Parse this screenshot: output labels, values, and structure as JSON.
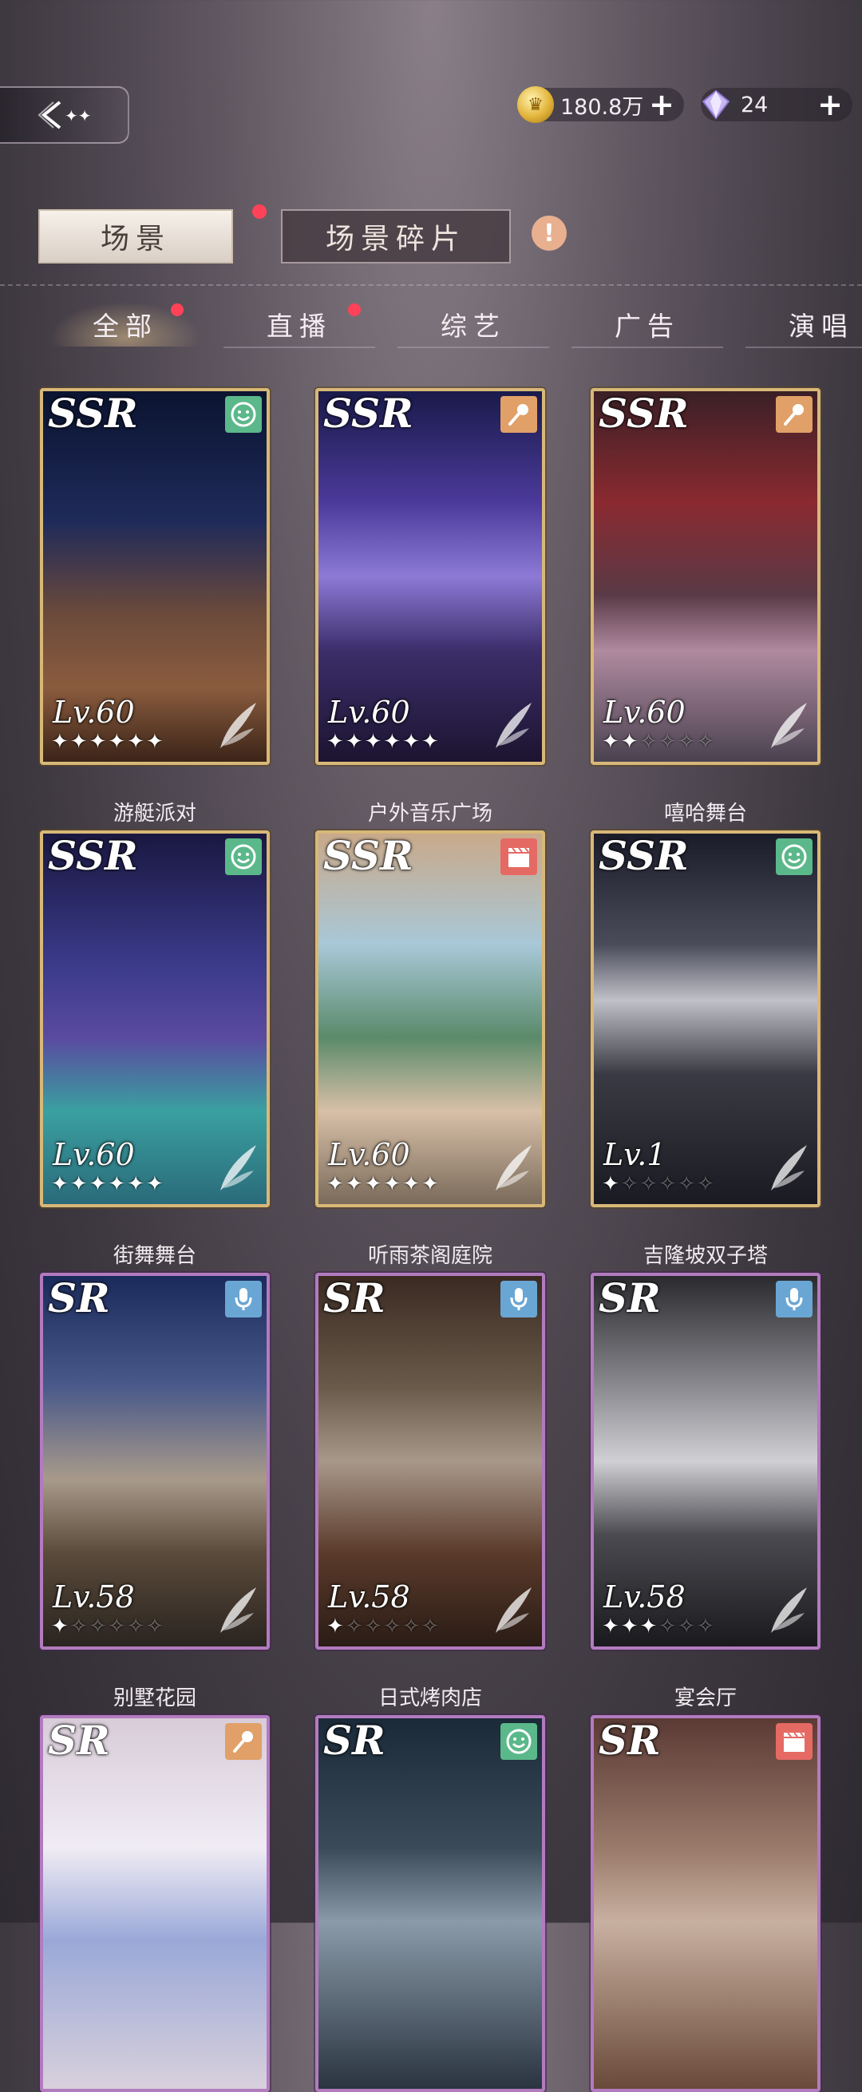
{
  "header": {
    "back_icon": "back-arrow-icon",
    "gold": {
      "icon": "gold-coin-icon",
      "value": "180.8万",
      "plus": "+"
    },
    "diamond": {
      "icon": "diamond-icon",
      "value": "24",
      "plus": "+"
    }
  },
  "tabs": {
    "scene": "场景",
    "fragments": "场景碎片",
    "info": "!"
  },
  "categories": [
    "全部",
    "直播",
    "综艺",
    "广告",
    "演唱"
  ],
  "cards": [
    {
      "rarity": "SSR",
      "type": "smile",
      "level": "Lv.60",
      "stars_on": 6,
      "name": "游艇派对"
    },
    {
      "rarity": "SSR",
      "type": "mic",
      "level": "Lv.60",
      "stars_on": 6,
      "name": "户外音乐广场"
    },
    {
      "rarity": "SSR",
      "type": "mic",
      "level": "Lv.60",
      "stars_on": 2,
      "name": "嘻哈舞台"
    },
    {
      "rarity": "SSR",
      "type": "smile",
      "level": "Lv.60",
      "stars_on": 6,
      "name": "街舞舞台"
    },
    {
      "rarity": "SSR",
      "type": "clapper",
      "level": "Lv.60",
      "stars_on": 6,
      "name": "听雨茶阁庭院"
    },
    {
      "rarity": "SSR",
      "type": "smile",
      "level": "Lv.1",
      "stars_on": 1,
      "name": "吉隆坡双子塔"
    },
    {
      "rarity": "SR",
      "type": "podcast",
      "level": "Lv.58",
      "stars_on": 1,
      "name": "别墅花园"
    },
    {
      "rarity": "SR",
      "type": "podcast",
      "level": "Lv.58",
      "stars_on": 1,
      "name": "日式烤肉店"
    },
    {
      "rarity": "SR",
      "type": "podcast",
      "level": "Lv.58",
      "stars_on": 3,
      "name": "宴会厅"
    },
    {
      "rarity": "SR",
      "type": "mic",
      "level": "",
      "stars_on": 0,
      "name": ""
    },
    {
      "rarity": "SR",
      "type": "smile",
      "level": "",
      "stars_on": 0,
      "name": ""
    },
    {
      "rarity": "SR",
      "type": "clapper",
      "level": "",
      "stars_on": 0,
      "name": ""
    }
  ],
  "badge_colors": {
    "smile": "#5bb88a",
    "mic": "#e0a067",
    "clapper": "#e56a63",
    "podcast": "#6aa6d4"
  },
  "total_stars": 6
}
